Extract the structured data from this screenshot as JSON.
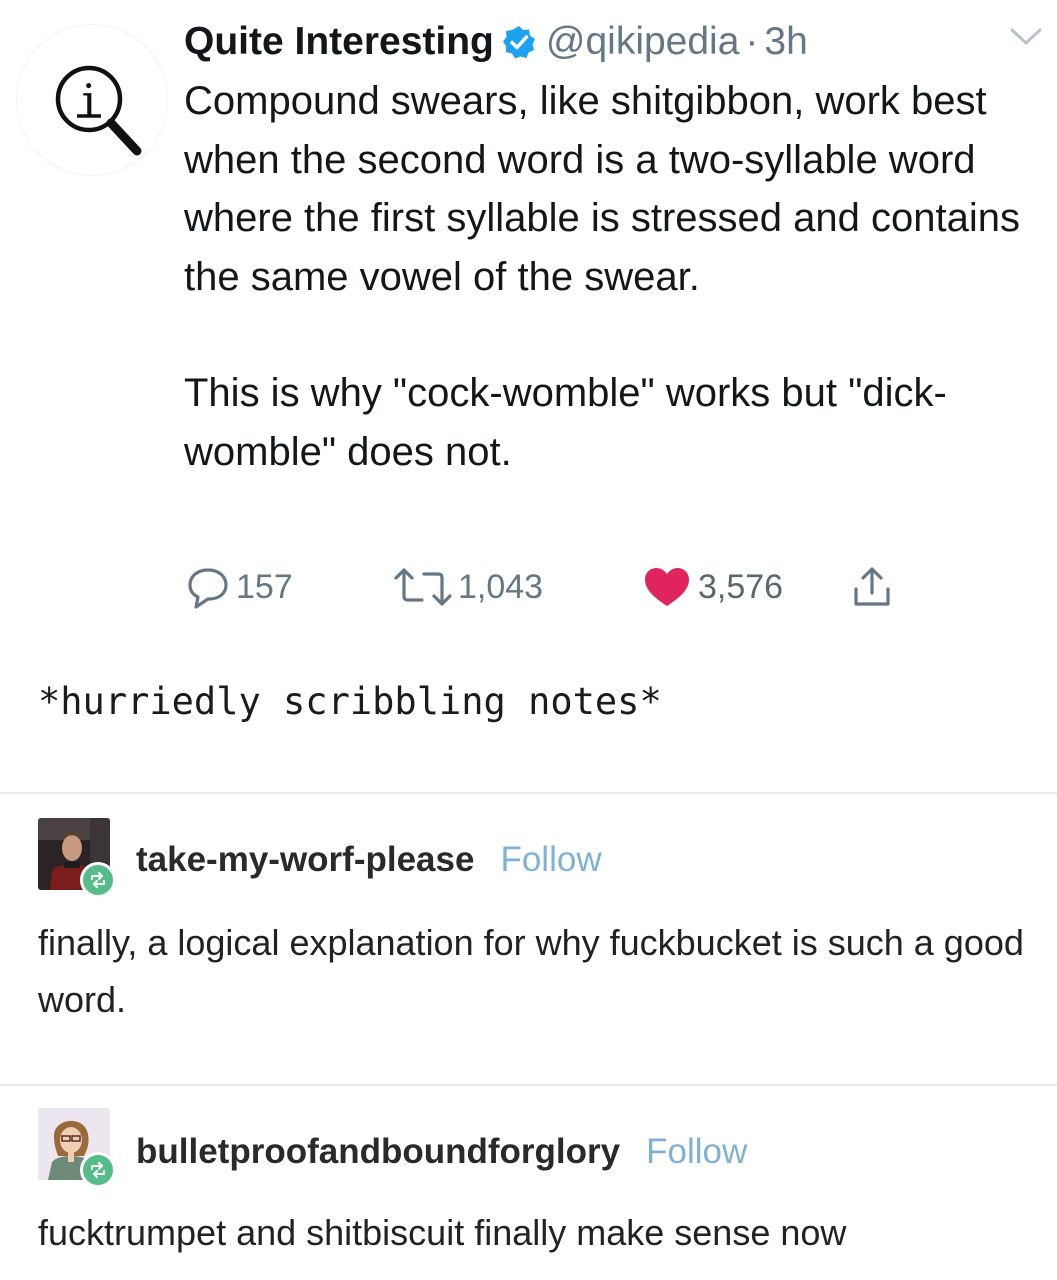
{
  "tweet": {
    "display_name": "Quite Interesting",
    "handle": "@qikipedia",
    "separator": "·",
    "time": "3h",
    "paragraphs": [
      "Compound swears, like shitgibbon, work best when the second word is a two-syllable word where the first syllable is stressed and contains the same vowel of the swear.",
      "This is why \"cock-womble\" works but \"dick-womble\" does not."
    ],
    "reply_count": "157",
    "retweet_count": "1,043",
    "like_count": "3,576",
    "icons": {
      "avatar": "magnifier-info-icon",
      "verified": "verified-badge-icon",
      "menu": "chevron-down-icon",
      "reply": "speech-bubble-icon",
      "retweet": "retweet-icon",
      "like": "heart-icon",
      "share": "share-icon"
    },
    "colors": {
      "verified": "#1da1f2",
      "like": "#e0245e",
      "muted": "#657786"
    }
  },
  "caption": "*hurriedly scribbling notes*",
  "reblogs": [
    {
      "username": "take-my-worf-please",
      "follow_label": "Follow",
      "text": "finally, a logical explanation for why fuckbucket is such a good word."
    },
    {
      "username": "bulletproofandboundforglory",
      "follow_label": "Follow",
      "text": "fucktrumpet and shitbiscuit finally make sense now"
    }
  ],
  "colors": {
    "follow": "#7fb1d4",
    "reblog_badge": "#56bc8a"
  }
}
